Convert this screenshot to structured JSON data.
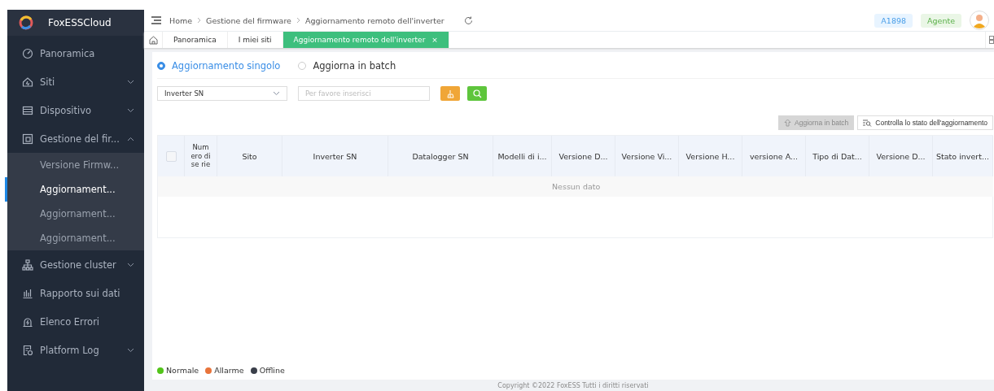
{
  "sidebar": {
    "brand": "FoxESSCloud",
    "items": [
      {
        "label": "Panoramica",
        "kind": "link"
      },
      {
        "label": "Siti",
        "kind": "group",
        "expanded": false
      },
      {
        "label": "Dispositivo",
        "kind": "group",
        "expanded": false
      },
      {
        "label": "Gestione del fir...",
        "kind": "group",
        "expanded": true,
        "children": [
          {
            "label": "Versione Firmw...",
            "selected": false
          },
          {
            "label": "Aggiornament...",
            "selected": true
          },
          {
            "label": "Aggiornament...",
            "selected": false
          },
          {
            "label": "Aggiornament...",
            "selected": false
          }
        ]
      },
      {
        "label": "Gestione cluster",
        "kind": "group",
        "expanded": false
      },
      {
        "label": "Rapporto sui dati",
        "kind": "link"
      },
      {
        "label": "Elenco Errori",
        "kind": "link"
      },
      {
        "label": "Platform Log",
        "kind": "group",
        "expanded": false
      }
    ]
  },
  "header": {
    "breadcrumbs": [
      "Home",
      "Gestione del firmware",
      "Aggiornamento remoto dell'inverter"
    ],
    "account": "A1898",
    "role": "Agente"
  },
  "tabs": [
    {
      "label": "Panoramica",
      "selected": false
    },
    {
      "label": "I miei siti",
      "selected": false
    },
    {
      "label": "Aggiornamento remoto dell'inverter",
      "selected": true,
      "close": "×"
    }
  ],
  "mode_radios": [
    {
      "label": "Aggiornamento singolo",
      "selected": true
    },
    {
      "label": "Aggiorna in batch",
      "selected": false
    }
  ],
  "filter": {
    "field": "Inverter SN",
    "placeholder": "Per favore inserisci"
  },
  "actions": [
    {
      "label": "Aggiorna in batch",
      "disabled": true
    },
    {
      "label": "Controlla lo stato dell'aggiornamento",
      "disabled": false
    }
  ],
  "table": {
    "columns": [
      "Num ero di se rie",
      "Sito",
      "Inverter SN",
      "Datalogger SN",
      "Modelli di i...",
      "Versione D...",
      "Versione Vi...",
      "Versione H...",
      "versione A...",
      "Tipo di Dat...",
      "Versione D...",
      "Stato invert..."
    ],
    "select_all_checked": false,
    "empty_text": "Nessun dato"
  },
  "legend": [
    {
      "label": "Normale",
      "color": "#52c41a"
    },
    {
      "label": "Allarme",
      "color": "#e8743b"
    },
    {
      "label": "Offline",
      "color": "#3a3f4a"
    }
  ],
  "footer": "Copyright ©2022 FoxESS Tutti i diritti riservati"
}
